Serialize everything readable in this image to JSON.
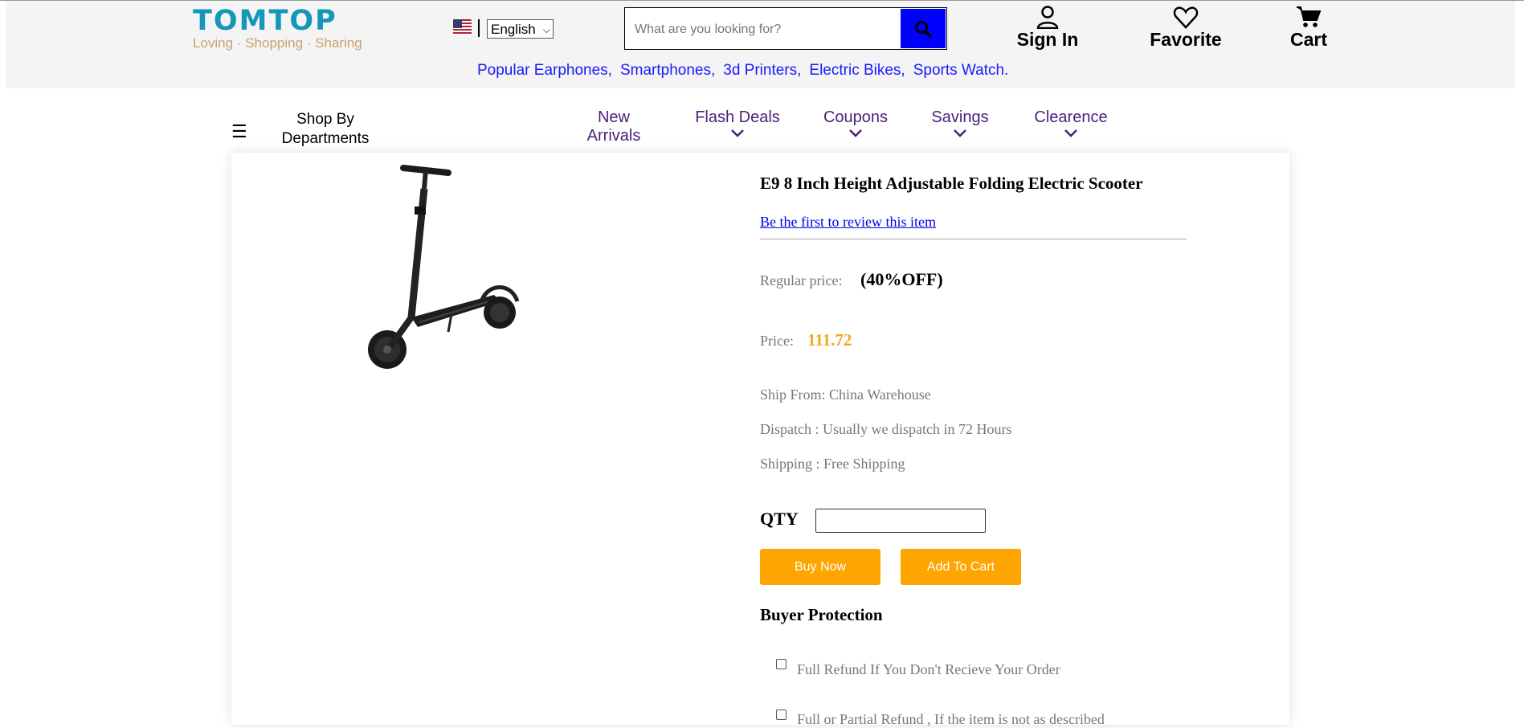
{
  "header": {
    "logo": "TOMTOP",
    "tagline": "Loving · Shopping · Sharing",
    "language": "English",
    "search": {
      "placeholder": "What are you looking for?"
    },
    "sign_in": "Sign In",
    "favorite": "Favorite",
    "cart": "Cart",
    "popular": [
      "Popular Earphones,",
      "Smartphones,",
      "3d Printers,",
      "Electric Bikes,",
      "Sports Watch."
    ]
  },
  "nav": {
    "shop_by": "Shop By Departments",
    "items": [
      {
        "label": "New Arrivals"
      },
      {
        "label": "Flash Deals"
      },
      {
        "label": "Coupons"
      },
      {
        "label": "Savings"
      },
      {
        "label": "Clearence"
      }
    ]
  },
  "product": {
    "title": "E9 8 Inch Height Adjustable Folding Electric Scooter",
    "review_link": "Be the first to review this item",
    "regular_price_label": "Regular price:",
    "discount": "(40%OFF)",
    "price_label": "Price:",
    "price": "111.72",
    "ship_from": "Ship From: China Warehouse",
    "dispatch": "Dispatch : Usually we dispatch in 72 Hours",
    "shipping": "Shipping : Free Shipping",
    "qty_label": "QTY",
    "qty_value": "",
    "buy_now": "Buy Now",
    "add_to_cart": "Add To Cart",
    "buyer_protection": "Buyer Protection",
    "protections": [
      "Full Refund If You Don't Recieve Your Order",
      "Full or Partial Refund , If the item is not as described"
    ]
  },
  "colors": {
    "accent": "#ffa500",
    "search_button": "#0000ff",
    "nav_text": "#4b1f7a",
    "logo": "#1497b8"
  }
}
